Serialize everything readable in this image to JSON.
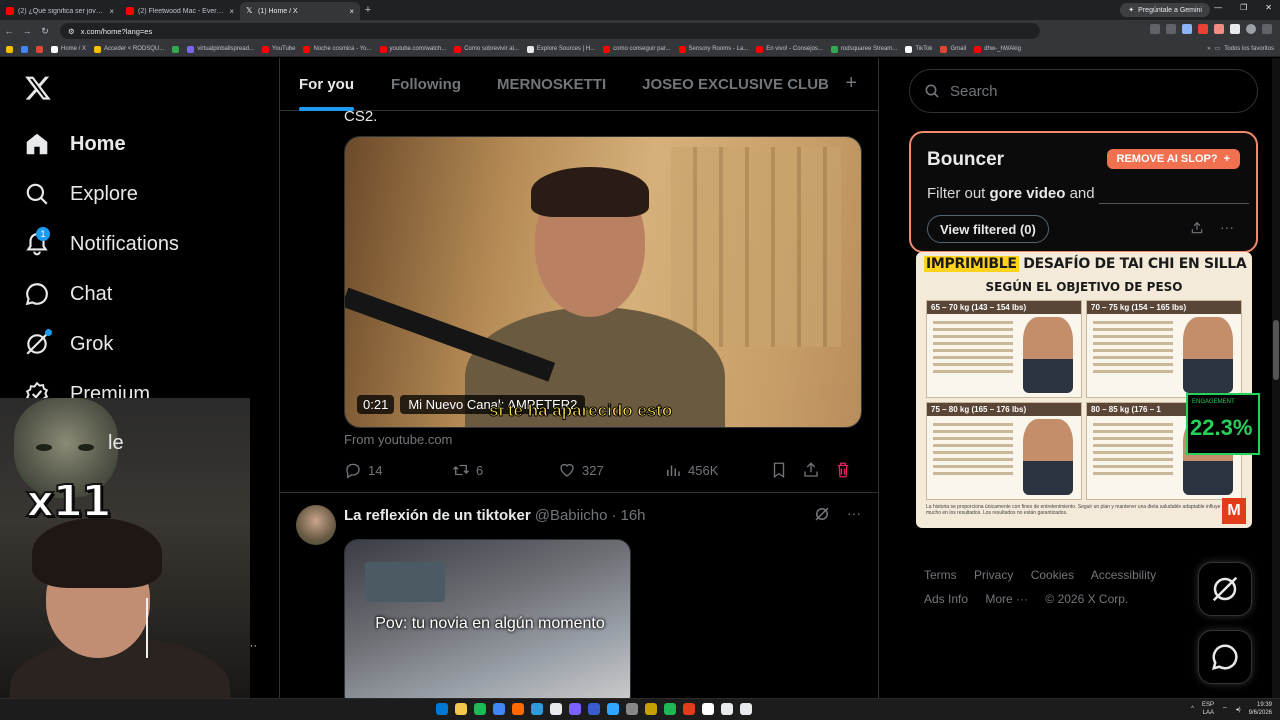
{
  "browser": {
    "tabs": [
      {
        "title": "(2) ¿Qué significa ser joven? (1...",
        "favicon_color": "#ff0000",
        "active": false
      },
      {
        "title": "(2) Fleetwood Mac - Everywhere",
        "favicon_color": "#ff0000",
        "active": false
      },
      {
        "title": "(1) Home / X",
        "favicon_color": "#ffffff",
        "active": true
      }
    ],
    "new_tab_symbol": "+",
    "gemini_button": "Pregúntale a Gemini",
    "url": "x.com/home?lang=es",
    "bookmarks": [
      {
        "label": "",
        "color": "#fbbc04"
      },
      {
        "label": "",
        "color": "#4285f4"
      },
      {
        "label": "",
        "color": "#ea4335"
      },
      {
        "label": "Home / X",
        "color": "#ffffff"
      },
      {
        "label": "Acceder < RODSQU...",
        "color": "#fbbc04"
      },
      {
        "label": "",
        "color": "#34a853"
      },
      {
        "label": "virtualpinballspread...",
        "color": "#7b68ee"
      },
      {
        "label": "YouTube",
        "color": "#ff0000"
      },
      {
        "label": "Noche cosmica - Yo...",
        "color": "#ff0000"
      },
      {
        "label": "youtube.com/watch...",
        "color": "#ff0000"
      },
      {
        "label": "Como sobrevivir al...",
        "color": "#ff0000"
      },
      {
        "label": "Explore Sources | H...",
        "color": "#e8eaed"
      },
      {
        "label": "como conseguir par...",
        "color": "#ff0000"
      },
      {
        "label": "Sensory Rooms - La...",
        "color": "#ff0000"
      },
      {
        "label": "En vivo! - Consejos...",
        "color": "#ff0000"
      },
      {
        "label": "rodsquaree Stream...",
        "color": "#34a853"
      },
      {
        "label": "TikTok",
        "color": "#ffffff"
      },
      {
        "label": "Gmail",
        "color": "#ea4335"
      },
      {
        "label": "dhw-_hWAkig",
        "color": "#ff0000"
      }
    ],
    "bookmarks_more": "»",
    "all_bookmarks": "Todos los favoritos"
  },
  "nav": {
    "items": [
      {
        "label": "Home",
        "icon": "home-icon",
        "active": true
      },
      {
        "label": "Explore",
        "icon": "search-icon",
        "active": false
      },
      {
        "label": "Notifications",
        "icon": "bell-icon",
        "active": false,
        "badge": "1"
      },
      {
        "label": "Chat",
        "icon": "chat-icon",
        "active": false
      },
      {
        "label": "Grok",
        "icon": "grok-icon",
        "active": false
      },
      {
        "label": "Premium",
        "icon": "premium-icon",
        "active": false
      }
    ],
    "partial_label": "le",
    "more_dots": "···"
  },
  "webcam": {
    "overlay_text": "x11"
  },
  "feed": {
    "tabs": [
      {
        "label": "For you",
        "active": true
      },
      {
        "label": "Following",
        "active": false
      },
      {
        "label": "MERNOSKETTI",
        "active": false
      },
      {
        "label": "JOSEO EXCLUSIVE CLUB",
        "active": false
      }
    ],
    "add_tab": "+",
    "post1": {
      "cutoff_text": "CS2.",
      "video_time": "0:21",
      "video_title": "Mi Nuevo Canal: AMPETER2",
      "video_subtitle": "si te ha aparecido esto",
      "source": "From youtube.com",
      "replies": "14",
      "reposts": "6",
      "likes": "327",
      "views": "456K"
    },
    "post2": {
      "name": "La reflexión de un tiktoker",
      "handle": "@Babiicho",
      "time": "16h",
      "media_caption": "Pov: tu novia en algún momento",
      "more": "···"
    }
  },
  "right": {
    "search_placeholder": "Search",
    "bouncer": {
      "title": "Bouncer",
      "remove_button": "REMOVE AI SLOP?",
      "remove_symbol": "+",
      "desc_prefix": "Filter out",
      "desc_bold": "gore video",
      "desc_suffix": "and",
      "view_filtered": "View filtered",
      "filtered_count": "(0)",
      "more": "···"
    },
    "ad": {
      "title_highlight": "IMPRIMIBLE",
      "title_rest": "DESAFÍO DE TAI CHI EN SILLA",
      "subtitle": "SEGÚN EL OBJETIVO DE PESO",
      "cells": [
        "65 – 70 kg (143 – 154 lbs)",
        "70 – 75 kg (154 – 165 lbs)",
        "75 – 80 kg (165 – 176 lbs)",
        "80 – 85 kg (176 – 1"
      ],
      "footer": "La historia se proporciona únicamente con fines de entretenimiento. Seguir un plan y mantener una dieta saludable adaptable influye mucho en los resultados. Los resultados no están garantizados.",
      "logo": "M"
    },
    "engagement": {
      "label": "ENGAGEMENT",
      "value": "22.3%"
    },
    "footer_links": [
      "Terms",
      "Privacy",
      "Cookies",
      "Accessibility",
      "Ads Info",
      "More ···",
      "© 2026 X Corp."
    ]
  },
  "taskbar": {
    "lang_line1": "ESP",
    "lang_line2": "LAA",
    "time": "19:39",
    "date": "9/6/2026",
    "app_colors": [
      "#0078d4",
      "#f2c94c",
      "#1db954",
      "#4285f4",
      "#ff6a00",
      "#2d9cdb",
      "#e8eaed",
      "#7b61ff",
      "#3b5ccc",
      "#31a8ff",
      "#888888",
      "#c4a000",
      "#1db954",
      "#e23c1a",
      "#ffffff",
      "#e8eaed",
      "#e8eaed"
    ]
  }
}
